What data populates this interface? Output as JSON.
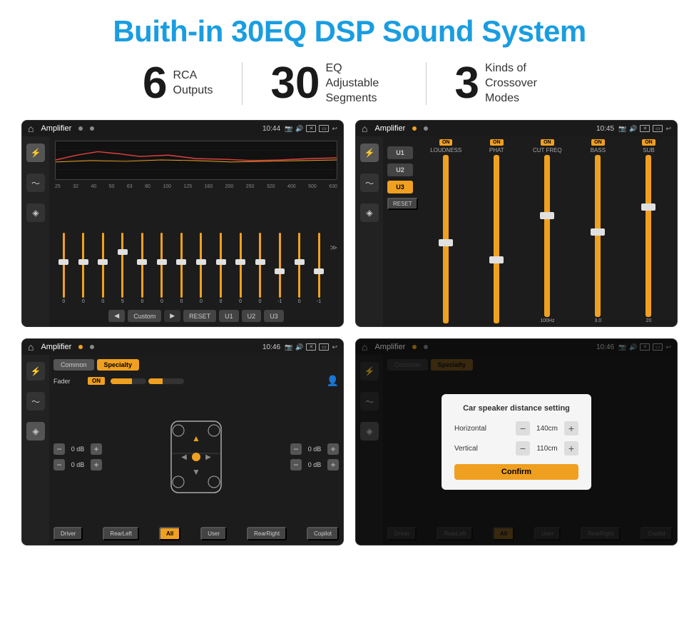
{
  "header": {
    "title": "Buith-in 30EQ DSP Sound System"
  },
  "stats": [
    {
      "number": "6",
      "label": "RCA\nOutputs"
    },
    {
      "number": "30",
      "label": "EQ Adjustable\nSegments"
    },
    {
      "number": "3",
      "label": "Kinds of\nCrossover Modes"
    }
  ],
  "screens": [
    {
      "id": "eq-screen",
      "title": "Amplifier",
      "time": "10:44",
      "type": "eq",
      "freqs": [
        "25",
        "32",
        "40",
        "50",
        "63",
        "80",
        "100",
        "125",
        "160",
        "200",
        "250",
        "320",
        "400",
        "500",
        "630"
      ],
      "values": [
        "0",
        "0",
        "0",
        "5",
        "0",
        "0",
        "0",
        "0",
        "0",
        "0",
        "0",
        "-1",
        "0",
        "-1"
      ],
      "buttons": [
        "◀",
        "Custom",
        "▶",
        "RESET",
        "U1",
        "U2",
        "U3"
      ]
    },
    {
      "id": "crossover-screen",
      "title": "Amplifier",
      "time": "10:45",
      "type": "crossover",
      "presets": [
        "U1",
        "U2",
        "U3"
      ],
      "channels": [
        "LOUDNESS",
        "PHAT",
        "CUT FREQ",
        "BASS",
        "SUB"
      ],
      "reset_label": "RESET"
    },
    {
      "id": "fader-screen",
      "title": "Amplifier",
      "time": "10:46",
      "type": "fader",
      "tabs": [
        "Common",
        "Specialty"
      ],
      "fader_label": "Fader",
      "fader_on": "ON",
      "volumes": [
        "0 dB",
        "0 dB",
        "0 dB",
        "0 dB"
      ],
      "buttons": [
        "Driver",
        "RearLeft",
        "All",
        "User",
        "RearRight",
        "Copilot"
      ]
    },
    {
      "id": "distance-screen",
      "title": "Amplifier",
      "time": "10:46",
      "type": "distance",
      "tabs": [
        "Common",
        "Specialty"
      ],
      "dialog": {
        "title": "Car speaker distance setting",
        "horizontal_label": "Horizontal",
        "horizontal_value": "140cm",
        "vertical_label": "Vertical",
        "vertical_value": "110cm",
        "confirm_label": "Confirm"
      },
      "buttons": [
        "Driver",
        "RearLeft",
        "All",
        "User",
        "RearRight",
        "Copilot"
      ]
    }
  ]
}
